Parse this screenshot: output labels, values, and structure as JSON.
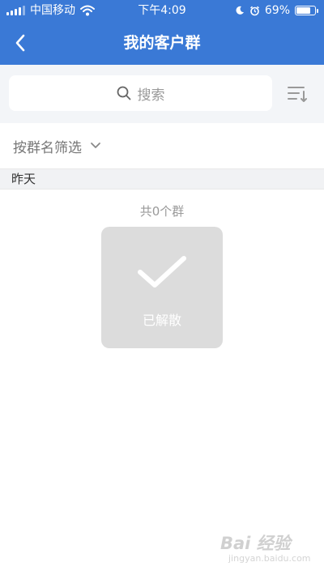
{
  "status_bar": {
    "carrier": "中国移动",
    "time": "下午4:09",
    "battery": "69%",
    "battery_level": 0.69
  },
  "nav": {
    "title": "我的客户群",
    "back_icon": "chevron-left-icon"
  },
  "search": {
    "placeholder": "搜索",
    "icon": "search-icon",
    "sort_icon": "sort-icon"
  },
  "filter": {
    "label": "按群名筛选",
    "icon": "chevron-down-icon"
  },
  "section": {
    "title": "昨天"
  },
  "summary": {
    "count_text": "共0个群"
  },
  "card": {
    "icon": "check-icon",
    "label": "已解散"
  },
  "watermark": {
    "brand": "Bai 经验",
    "url": "jingyan.baidu.com"
  },
  "colors": {
    "primary": "#3a79d6",
    "card_bg": "#dcdcdc",
    "search_bg": "#f3f5f8"
  }
}
